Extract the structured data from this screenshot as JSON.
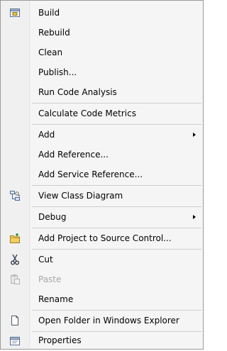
{
  "menu": {
    "build": "Build",
    "rebuild": "Rebuild",
    "clean": "Clean",
    "publish": "Publish...",
    "run_code_analysis": "Run Code Analysis",
    "calculate_code_metrics": "Calculate Code Metrics",
    "add": "Add",
    "add_reference": "Add Reference...",
    "add_service_reference": "Add Service Reference...",
    "view_class_diagram": "View Class Diagram",
    "debug": "Debug",
    "add_project_to_source_control": "Add Project to Source Control...",
    "cut": "Cut",
    "paste": "Paste",
    "rename": "Rename",
    "open_folder": "Open Folder in Windows Explorer",
    "properties": "Properties"
  },
  "icons": {
    "build": "build-icon",
    "view_class_diagram": "class-diagram-icon",
    "add_project_to_source_control": "source-control-icon",
    "cut": "scissors-icon",
    "paste": "paste-icon",
    "open_folder": "open-folder-icon",
    "properties": "properties-icon"
  }
}
